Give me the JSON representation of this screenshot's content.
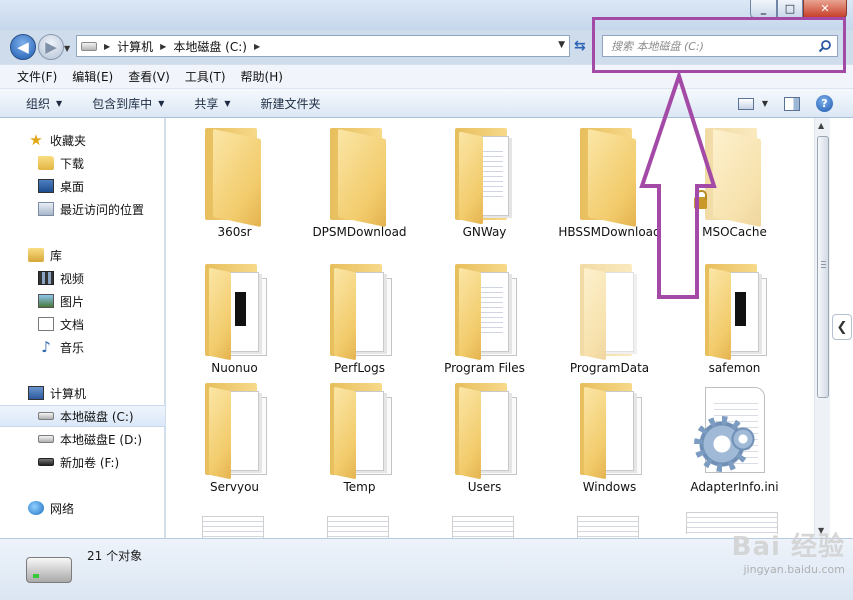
{
  "breadcrumb": [
    "计算机",
    "本地磁盘 (C:)"
  ],
  "search": {
    "placeholder": "搜索 本地磁盘 (C:)"
  },
  "menu": [
    "文件(F)",
    "编辑(E)",
    "查看(V)",
    "工具(T)",
    "帮助(H)"
  ],
  "toolbar": {
    "organize": "组织",
    "include": "包含到库中",
    "share": "共享",
    "newfolder": "新建文件夹"
  },
  "nav": {
    "favorites": "收藏夹",
    "downloads": "下载",
    "desktop": "桌面",
    "recent": "最近访问的位置",
    "libraries": "库",
    "videos": "视频",
    "pictures": "图片",
    "documents": "文档",
    "music": "音乐",
    "computer": "计算机",
    "drive_c": "本地磁盘 (C:)",
    "drive_e": "本地磁盘E (D:)",
    "drive_f": "新加卷 (F:)",
    "network": "网络"
  },
  "files": [
    "360sr",
    "DPSMDownload",
    "GNWay",
    "HBSSMDownload",
    "MSOCache",
    "Nuonuo",
    "PerfLogs",
    "Program Files",
    "ProgramData",
    "safemon",
    "Servyou",
    "Temp",
    "Users",
    "Windows",
    "AdapterInfo.ini"
  ],
  "status": {
    "count": "21 个对象"
  },
  "watermark": {
    "main": "Bai 经验",
    "url": "jingyan.baidu.com"
  }
}
